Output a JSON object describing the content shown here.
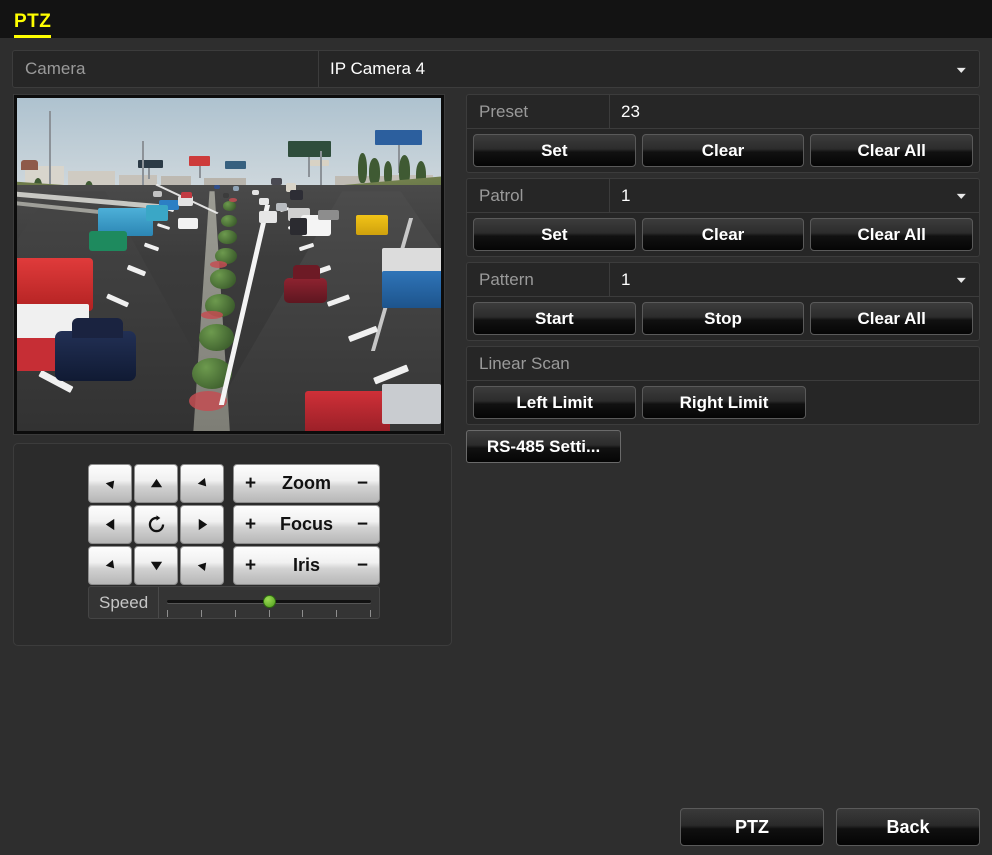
{
  "window": {
    "title": "PTZ"
  },
  "camera": {
    "label": "Camera",
    "value": "IP Camera 4",
    "chevron": "chevron-down-icon"
  },
  "preview": {
    "name": "live-video-preview"
  },
  "ptz_controls": {
    "dpad": {
      "up_left": "arrow-up-left-icon",
      "up": "arrow-up-icon",
      "up_right": "arrow-up-right-icon",
      "left": "arrow-left-icon",
      "auto": "auto-scan-rotate-icon",
      "right": "arrow-right-icon",
      "down_left": "arrow-down-left-icon",
      "down": "arrow-down-icon",
      "down_right": "arrow-down-right-icon"
    },
    "lens": [
      {
        "name": "Zoom",
        "plus": "+",
        "minus": "−"
      },
      {
        "name": "Focus",
        "plus": "+",
        "minus": "−"
      },
      {
        "name": "Iris",
        "plus": "+",
        "minus": "−"
      }
    ],
    "speed": {
      "label": "Speed",
      "value": 50,
      "min": 0,
      "max": 100,
      "ticks": 7
    }
  },
  "settings": {
    "preset": {
      "label": "Preset",
      "value": "23",
      "buttons": [
        "Set",
        "Clear",
        "Clear All"
      ]
    },
    "patrol": {
      "label": "Patrol",
      "value": "1",
      "chevron": "chevron-down-icon",
      "buttons": [
        "Set",
        "Clear",
        "Clear All"
      ]
    },
    "pattern": {
      "label": "Pattern",
      "value": "1",
      "chevron": "chevron-down-icon",
      "buttons": [
        "Start",
        "Stop",
        "Clear All"
      ]
    },
    "linear_scan": {
      "label": "Linear Scan",
      "buttons": [
        "Left Limit",
        "Right Limit"
      ]
    },
    "rs485": {
      "label": "RS-485 Setti..."
    }
  },
  "footer": {
    "ptz_label": "PTZ",
    "back_label": "Back"
  },
  "colors": {
    "accent": "#ffff00",
    "background": "#2e2e2e",
    "titlebar": "#131313",
    "slider_knob": "#6cc22b"
  }
}
